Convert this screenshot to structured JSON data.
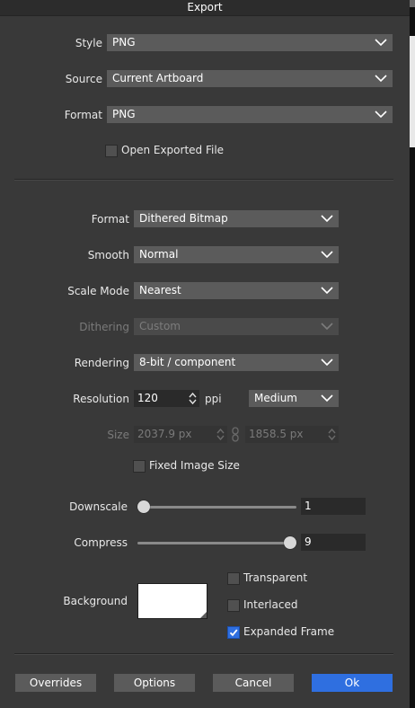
{
  "window": {
    "title": "Export"
  },
  "top_section": {
    "style": {
      "label": "Style",
      "value": "PNG"
    },
    "source": {
      "label": "Source",
      "value": "Current Artboard"
    },
    "format": {
      "label": "Format",
      "value": "PNG"
    },
    "open_exported_file": {
      "label": "Open Exported File",
      "checked": false
    }
  },
  "settings": {
    "format": {
      "label": "Format",
      "value": "Dithered Bitmap"
    },
    "smooth": {
      "label": "Smooth",
      "value": "Normal"
    },
    "scale_mode": {
      "label": "Scale Mode",
      "value": "Nearest"
    },
    "dithering": {
      "label": "Dithering",
      "value": "Custom",
      "disabled": true
    },
    "rendering": {
      "label": "Rendering",
      "value": "8-bit / component"
    },
    "resolution": {
      "label": "Resolution",
      "value": "120",
      "unit": "ppi",
      "quality": "Medium"
    },
    "size": {
      "label": "Size",
      "width": "2037.9 px",
      "height": "1858.5 px",
      "disabled": true
    },
    "fixed_image_size": {
      "label": "Fixed Image Size",
      "checked": false
    },
    "downscale": {
      "label": "Downscale",
      "value": "1",
      "fraction": 0.0
    },
    "compress": {
      "label": "Compress",
      "value": "9",
      "fraction": 1.0
    },
    "background": {
      "label": "Background",
      "color": "#ffffff"
    },
    "transparent": {
      "label": "Transparent",
      "checked": false
    },
    "interlaced": {
      "label": "Interlaced",
      "checked": false
    },
    "expanded_frame": {
      "label": "Expanded Frame",
      "checked": true
    }
  },
  "buttons": {
    "overrides": "Overrides",
    "options": "Options",
    "cancel": "Cancel",
    "ok": "Ok"
  },
  "colors": {
    "accent": "#2f6fe0",
    "panel": "#393939",
    "control": "#5b5b5b"
  }
}
